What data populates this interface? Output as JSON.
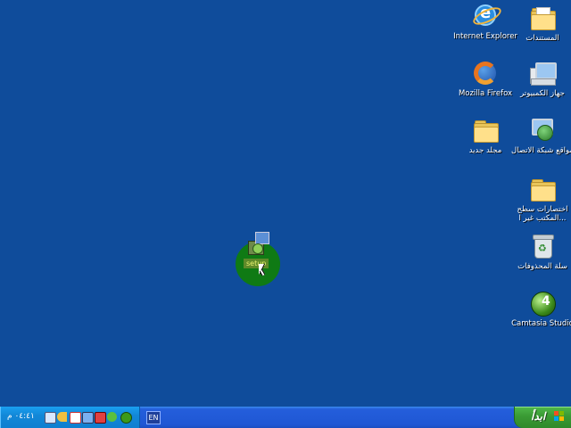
{
  "desktop": {
    "icons": [
      {
        "id": "documents",
        "label": "المستندات"
      },
      {
        "id": "internet-explorer",
        "label": "Internet Explorer"
      },
      {
        "id": "my-computer",
        "label": "جهاز الكمبيوتر"
      },
      {
        "id": "firefox",
        "label": "Mozilla Firefox"
      },
      {
        "id": "network-places",
        "label": "مواقع شبكة الاتصال"
      },
      {
        "id": "new-folder",
        "label": "مجلد جديد"
      },
      {
        "id": "shortcuts",
        "label": "اختصارات سطح المكتب غير ا..."
      },
      {
        "id": "recycle-bin",
        "label": "سلة المحذوفات"
      },
      {
        "id": "camtasia",
        "label": "Camtasia Studio"
      }
    ],
    "setup": {
      "label": "setup"
    }
  },
  "taskbar": {
    "clock": "٠٤:٤١ م",
    "language": "EN",
    "start_label": "ابدأ"
  },
  "colors": {
    "desktop_bg": "#0f4c9b",
    "taskbar": "#245edb",
    "tray": "#0f7fd0",
    "start": "#3a9a34",
    "setup_highlight": "#0f7a14"
  }
}
